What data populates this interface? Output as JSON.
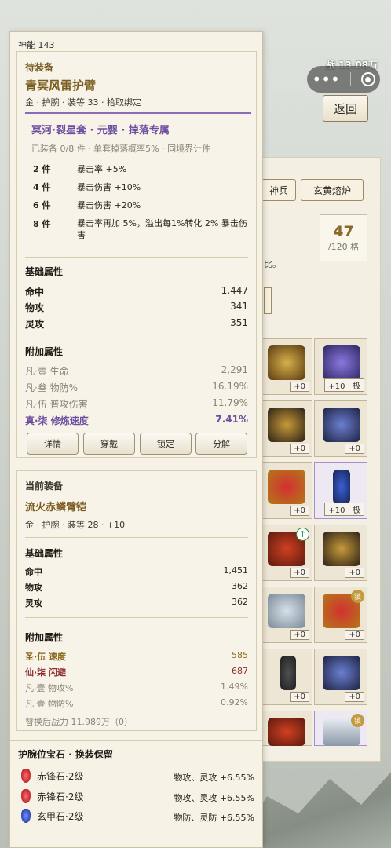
{
  "top": {
    "power_text": "战 13.08万",
    "back_label": "返回"
  },
  "right": {
    "tabs": [
      "神兵",
      "玄黄熔炉"
    ],
    "capacity_count": "47",
    "capacity_total": "/120 格",
    "hint_text": "比。",
    "slots": [
      {
        "level": "+0"
      },
      {
        "level": "+10 · 极"
      },
      {
        "level": "+0"
      },
      {
        "level": "+0"
      },
      {
        "level": "+0"
      },
      {
        "level": "+10 · 极"
      },
      {
        "level": "+0"
      },
      {
        "level": "+0"
      },
      {
        "level": "+0"
      },
      {
        "level": "+0"
      },
      {
        "level": "+0"
      },
      {
        "level": "+0"
      },
      {
        "level": ""
      },
      {
        "level": ""
      }
    ],
    "lock_label": "锁"
  },
  "popup": {
    "shen_neng": "神能 143",
    "pending": {
      "header": "待装备",
      "name": "青冥风雷护臂",
      "meta": "金 · 护腕 · 装等 33 · 拾取绑定",
      "set_name": "冥河·裂星套 · 元婴 · 掉落专属",
      "set_info": "已装备 0/8 件 · 单套掉落概率5% · 同境界计件",
      "set_bonuses": [
        {
          "pieces": "2 件",
          "desc": "暴击率 +5%"
        },
        {
          "pieces": "4 件",
          "desc": "暴击伤害 +10%"
        },
        {
          "pieces": "6 件",
          "desc": "暴击伤害 +20%"
        },
        {
          "pieces": "8 件",
          "desc": "暴击率再加 5%，溢出每1%转化 2% 暴击伤害"
        }
      ],
      "base_header": "基础属性",
      "base_stats": [
        {
          "k": "命中",
          "v": "1,447"
        },
        {
          "k": "物攻",
          "v": "341"
        },
        {
          "k": "灵攻",
          "v": "351"
        }
      ],
      "extra_header": "附加属性",
      "extra_stats": [
        {
          "k": "凡·壹 生命",
          "v": "2,291"
        },
        {
          "k": "凡·叁 物防%",
          "v": "16.19%"
        },
        {
          "k": "凡·伍 普攻伤害",
          "v": "11.79%"
        },
        {
          "k": "真·柒 修炼速度",
          "v": "7.41%"
        }
      ],
      "actions": [
        "详情",
        "穿戴",
        "锁定",
        "分解"
      ]
    },
    "current": {
      "header": "当前装备",
      "name": "流火赤鳞臂铠",
      "meta": "金 · 护腕 · 装等 28 · +10",
      "base_header": "基础属性",
      "base_stats": [
        {
          "k": "命中",
          "v": "1,451"
        },
        {
          "k": "物攻",
          "v": "362"
        },
        {
          "k": "灵攻",
          "v": "362"
        }
      ],
      "extra_header": "附加属性",
      "extra_stats": [
        {
          "k": "圣·伍 速度",
          "v": "585"
        },
        {
          "k": "仙·柒 闪避",
          "v": "687"
        },
        {
          "k": "凡·壹 物攻%",
          "v": "1.49%"
        },
        {
          "k": "凡·壹 物防%",
          "v": "0.92%"
        }
      ],
      "replace_info": "替换后战力 11.989万（0）"
    },
    "gems": {
      "header": "护腕位宝石 · 换装保留",
      "items": [
        {
          "name": "赤锋石·2级",
          "effect": "物攻、灵攻 +6.55%"
        },
        {
          "name": "赤锋石·2级",
          "effect": "物攻、灵攻 +6.55%"
        },
        {
          "name": "玄甲石·2级",
          "effect": "物防、灵防 +6.55%"
        }
      ]
    }
  }
}
